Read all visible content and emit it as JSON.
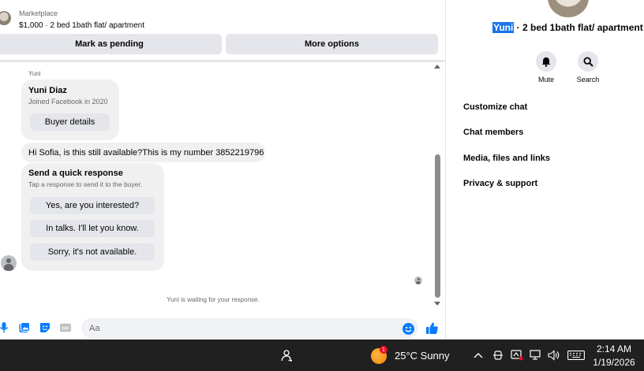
{
  "listing": {
    "source": "Marketplace",
    "title": "$1,000 · 2 bed 1bath flat/ apartment"
  },
  "actions": {
    "mark_pending": "Mark as pending",
    "more_options": "More options"
  },
  "conversation": {
    "sender_label": "Yuni",
    "profile_card": {
      "name": "Yuni Diaz",
      "joined": "Joined Facebook in 2020",
      "button": "Buyer details"
    },
    "message": "Hi Sofia, is this still available?This is my number 3852219796",
    "quick_response": {
      "title": "Send a quick response",
      "subtitle": "Tap a response to send it to the buyer.",
      "options": [
        "Yes, are you interested?",
        "In talks. I'll let you know.",
        "Sorry, it's not available."
      ]
    },
    "waiting_note": "Yuni is waiting for your response."
  },
  "composer": {
    "placeholder": "Aa",
    "accent_color": "#0a7cff",
    "icons": [
      "microphone-icon",
      "photo-icon",
      "sticker-icon",
      "gif-icon",
      "emoji-icon",
      "thumbs-up-icon"
    ],
    "gif_label": "GIF"
  },
  "info_pane": {
    "title_highlight": "Yuni",
    "title_rest": " · 2 bed 1bath flat/ apartment",
    "buttons": {
      "mute": "Mute",
      "search": "Search"
    },
    "menu": [
      "Customize chat",
      "Chat members",
      "Media, files and links",
      "Privacy & support"
    ]
  },
  "taskbar": {
    "weather_badge": "1",
    "weather": "25°C  Sunny",
    "time": "2:14 AM",
    "date": "1/19/2026"
  }
}
